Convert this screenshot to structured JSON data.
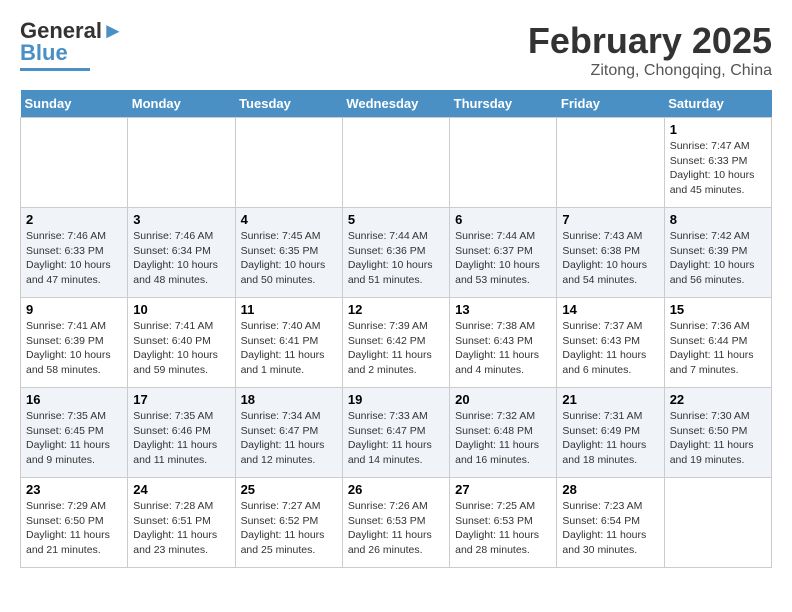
{
  "header": {
    "logo_line1": "General",
    "logo_line2": "Blue",
    "month": "February 2025",
    "location": "Zitong, Chongqing, China"
  },
  "weekdays": [
    "Sunday",
    "Monday",
    "Tuesday",
    "Wednesday",
    "Thursday",
    "Friday",
    "Saturday"
  ],
  "weeks": [
    [
      {
        "day": "",
        "info": ""
      },
      {
        "day": "",
        "info": ""
      },
      {
        "day": "",
        "info": ""
      },
      {
        "day": "",
        "info": ""
      },
      {
        "day": "",
        "info": ""
      },
      {
        "day": "",
        "info": ""
      },
      {
        "day": "1",
        "info": "Sunrise: 7:47 AM\nSunset: 6:33 PM\nDaylight: 10 hours\nand 45 minutes."
      }
    ],
    [
      {
        "day": "2",
        "info": "Sunrise: 7:46 AM\nSunset: 6:33 PM\nDaylight: 10 hours\nand 47 minutes."
      },
      {
        "day": "3",
        "info": "Sunrise: 7:46 AM\nSunset: 6:34 PM\nDaylight: 10 hours\nand 48 minutes."
      },
      {
        "day": "4",
        "info": "Sunrise: 7:45 AM\nSunset: 6:35 PM\nDaylight: 10 hours\nand 50 minutes."
      },
      {
        "day": "5",
        "info": "Sunrise: 7:44 AM\nSunset: 6:36 PM\nDaylight: 10 hours\nand 51 minutes."
      },
      {
        "day": "6",
        "info": "Sunrise: 7:44 AM\nSunset: 6:37 PM\nDaylight: 10 hours\nand 53 minutes."
      },
      {
        "day": "7",
        "info": "Sunrise: 7:43 AM\nSunset: 6:38 PM\nDaylight: 10 hours\nand 54 minutes."
      },
      {
        "day": "8",
        "info": "Sunrise: 7:42 AM\nSunset: 6:39 PM\nDaylight: 10 hours\nand 56 minutes."
      }
    ],
    [
      {
        "day": "9",
        "info": "Sunrise: 7:41 AM\nSunset: 6:39 PM\nDaylight: 10 hours\nand 58 minutes."
      },
      {
        "day": "10",
        "info": "Sunrise: 7:41 AM\nSunset: 6:40 PM\nDaylight: 10 hours\nand 59 minutes."
      },
      {
        "day": "11",
        "info": "Sunrise: 7:40 AM\nSunset: 6:41 PM\nDaylight: 11 hours\nand 1 minute."
      },
      {
        "day": "12",
        "info": "Sunrise: 7:39 AM\nSunset: 6:42 PM\nDaylight: 11 hours\nand 2 minutes."
      },
      {
        "day": "13",
        "info": "Sunrise: 7:38 AM\nSunset: 6:43 PM\nDaylight: 11 hours\nand 4 minutes."
      },
      {
        "day": "14",
        "info": "Sunrise: 7:37 AM\nSunset: 6:43 PM\nDaylight: 11 hours\nand 6 minutes."
      },
      {
        "day": "15",
        "info": "Sunrise: 7:36 AM\nSunset: 6:44 PM\nDaylight: 11 hours\nand 7 minutes."
      }
    ],
    [
      {
        "day": "16",
        "info": "Sunrise: 7:35 AM\nSunset: 6:45 PM\nDaylight: 11 hours\nand 9 minutes."
      },
      {
        "day": "17",
        "info": "Sunrise: 7:35 AM\nSunset: 6:46 PM\nDaylight: 11 hours\nand 11 minutes."
      },
      {
        "day": "18",
        "info": "Sunrise: 7:34 AM\nSunset: 6:47 PM\nDaylight: 11 hours\nand 12 minutes."
      },
      {
        "day": "19",
        "info": "Sunrise: 7:33 AM\nSunset: 6:47 PM\nDaylight: 11 hours\nand 14 minutes."
      },
      {
        "day": "20",
        "info": "Sunrise: 7:32 AM\nSunset: 6:48 PM\nDaylight: 11 hours\nand 16 minutes."
      },
      {
        "day": "21",
        "info": "Sunrise: 7:31 AM\nSunset: 6:49 PM\nDaylight: 11 hours\nand 18 minutes."
      },
      {
        "day": "22",
        "info": "Sunrise: 7:30 AM\nSunset: 6:50 PM\nDaylight: 11 hours\nand 19 minutes."
      }
    ],
    [
      {
        "day": "23",
        "info": "Sunrise: 7:29 AM\nSunset: 6:50 PM\nDaylight: 11 hours\nand 21 minutes."
      },
      {
        "day": "24",
        "info": "Sunrise: 7:28 AM\nSunset: 6:51 PM\nDaylight: 11 hours\nand 23 minutes."
      },
      {
        "day": "25",
        "info": "Sunrise: 7:27 AM\nSunset: 6:52 PM\nDaylight: 11 hours\nand 25 minutes."
      },
      {
        "day": "26",
        "info": "Sunrise: 7:26 AM\nSunset: 6:53 PM\nDaylight: 11 hours\nand 26 minutes."
      },
      {
        "day": "27",
        "info": "Sunrise: 7:25 AM\nSunset: 6:53 PM\nDaylight: 11 hours\nand 28 minutes."
      },
      {
        "day": "28",
        "info": "Sunrise: 7:23 AM\nSunset: 6:54 PM\nDaylight: 11 hours\nand 30 minutes."
      },
      {
        "day": "",
        "info": ""
      }
    ]
  ]
}
